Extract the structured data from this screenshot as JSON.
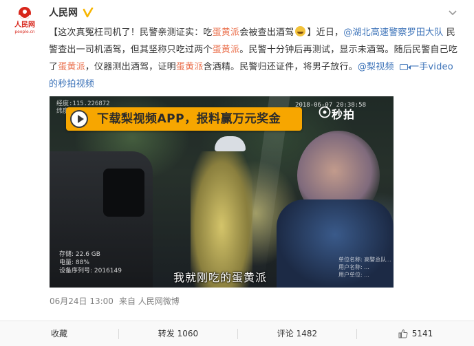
{
  "header": {
    "username": "人民网",
    "avatar_caption": "人民网 people.cn"
  },
  "post": {
    "segments": [
      {
        "text": "【这次真冤枉司机了！民警亲测证实：吃",
        "style": "plain"
      },
      {
        "text": "蛋黄派",
        "style": "highlight"
      },
      {
        "text": "会被查出酒驾",
        "style": "plain"
      },
      {
        "text": "】近日，",
        "style": "plain"
      },
      {
        "text": "@湖北高速警察罗田大队",
        "style": "mention"
      },
      {
        "text": " 民警查出一司机酒驾，但其坚称只吃过两个",
        "style": "plain"
      },
      {
        "text": "蛋黄派",
        "style": "highlight"
      },
      {
        "text": "。民警十分钟后再测试，显示未酒驾。随后民警自己吃了",
        "style": "plain"
      },
      {
        "text": "蛋黄派",
        "style": "highlight"
      },
      {
        "text": "，仪器测出酒驾，证明",
        "style": "plain"
      },
      {
        "text": "蛋黄派",
        "style": "highlight"
      },
      {
        "text": "含酒精。民警归还证件，将男子放行。",
        "style": "plain"
      },
      {
        "text": "@梨视频",
        "style": "mention"
      }
    ],
    "video_link_text": "一手video的秒拍视频"
  },
  "video": {
    "ad_text": "下载梨视频APP，报料赢万元奖金",
    "timestamp": "2018-06-07 20:38:58",
    "miaopai_label": "秒拍",
    "top_left_overlay": [
      "经度:115.226872",
      "纬度:"
    ],
    "device_info": [
      "存储: 22.6 GB",
      "电量: 88%",
      "设备序列号: 2016149"
    ],
    "subtitle": "我就刚吃的蛋黄派",
    "corner_info": [
      "单位名称: 高警总队...",
      "用户名称: ...",
      "用户单位: ..."
    ]
  },
  "meta": {
    "date": "06月24日 13:00",
    "source_prefix": "来自",
    "source_name": "人民网微博"
  },
  "actions": {
    "favorite": "收藏",
    "repost_label": "转发",
    "repost_count": "1060",
    "comment_label": "评论",
    "comment_count": "1482",
    "like_count": "5141"
  },
  "colors": {
    "accent_link": "#3b72b8",
    "highlight": "#eb7350",
    "ad_banner": "#f7a600",
    "brand_red": "#d8251a"
  },
  "icons": {
    "avatar": "people-daily-logo",
    "verified": "verified-badge-icon",
    "menu": "chevron-down-icon",
    "like": "thumbs-up-icon"
  }
}
